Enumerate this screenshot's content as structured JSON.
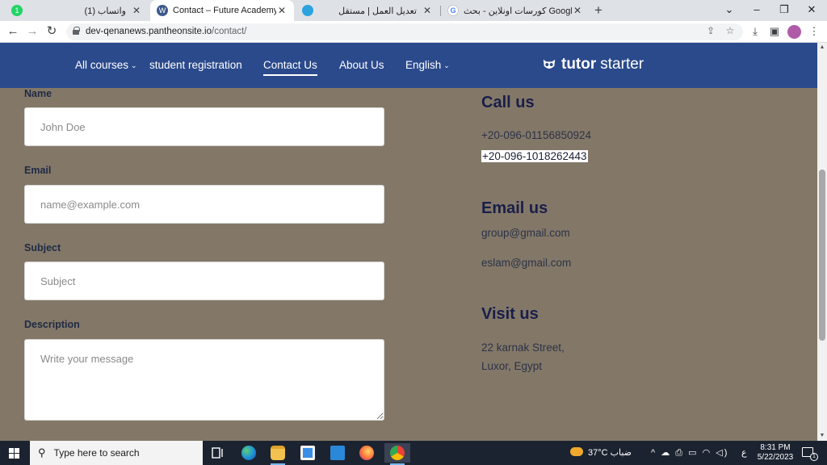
{
  "browser": {
    "tabs": [
      {
        "title": "(1) واتساب",
        "favicon_color": "#25d366",
        "favicon_text": "1",
        "close": "✕"
      },
      {
        "title": "Contact – Future Academy",
        "favicon_color": "#3c5a8a",
        "favicon_text": "W",
        "close": "✕"
      },
      {
        "title": "تعديل العمل | مستقل",
        "favicon_color": "#2aa3de",
        "favicon_text": "",
        "close": "✕"
      },
      {
        "title": "كورسات اونلاين - بحث Google",
        "favicon_color": "#4285f4",
        "favicon_text": "G",
        "close": "✕"
      }
    ],
    "new_tab": "+",
    "window_controls": {
      "tab_search": "⌄",
      "minimize": "–",
      "restore": "❐",
      "close": "✕"
    },
    "url_host": "dev-qenanews.pantheonsite.io",
    "url_path": "/contact/",
    "nav": {
      "back": "←",
      "forward": "→",
      "reload": "↻"
    },
    "omnibox_icons": {
      "share": "⇪",
      "star": "☆"
    },
    "toolbar_icons": {
      "download": "⤓",
      "side_panel": "▣",
      "menu": "⋮"
    }
  },
  "site": {
    "nav": {
      "all_courses": "All courses",
      "student_registration": "student registration",
      "contact_us": "Contact Us",
      "about_us": "About Us",
      "english": "English",
      "caret": "⌄"
    },
    "brand": {
      "bold": "tutor",
      "rest": "starter"
    }
  },
  "form": {
    "name_label": "Name",
    "name_placeholder": "John Doe",
    "email_label": "Email",
    "email_placeholder": "name@example.com",
    "subject_label": "Subject",
    "subject_placeholder": "Subject",
    "description_label": "Description",
    "description_placeholder": "Write your message"
  },
  "contact": {
    "call_heading": "Call us",
    "phone1": "+20-096-01156850924",
    "phone2": "+20-096-1018262443",
    "email_heading": "Email us",
    "email1": "group@gmail.com",
    "email2": "eslam@gmail.com",
    "visit_heading": "Visit us",
    "address_line1": "22 karnak Street,",
    "address_line2": "Luxor, Egypt"
  },
  "scrollbar": {
    "up": "▲",
    "down": "▼"
  },
  "taskbar": {
    "search_placeholder": "Type here to search",
    "search_icon": "⚲",
    "weather": "37°C  ضباب",
    "tray_icons": "^ ☁ ⎙ ▭ ◠ ◁)",
    "lang": "ع",
    "time": "8:31 PM",
    "date": "5/22/2023",
    "notifications": "1",
    "apps": [
      {
        "name": "task-view",
        "color": "#1c2330"
      },
      {
        "name": "edge",
        "color": "#1f8fd8"
      },
      {
        "name": "file-explorer",
        "color": "#f2c14e"
      },
      {
        "name": "store",
        "color": "#3a8ee6"
      },
      {
        "name": "mail",
        "color": "#2b88d8"
      },
      {
        "name": "firefox",
        "color": "#ff7139"
      },
      {
        "name": "chrome",
        "color": "#34a853"
      }
    ]
  }
}
